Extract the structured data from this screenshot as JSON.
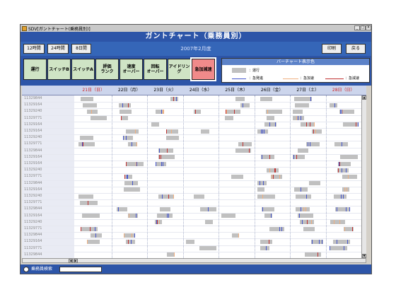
{
  "window": {
    "title": "SDV[ガントチャート(乗務員別)]",
    "min_label": "_",
    "max_label": "□",
    "close_label": "X"
  },
  "banner": {
    "title": "ガントチャート（乗務員別）"
  },
  "toolbar": {
    "range_buttons": [
      "12時間",
      "24時間",
      "8日間"
    ],
    "date_label": "2007年2月度",
    "print_label": "印刷",
    "back_label": "戻る"
  },
  "modes": [
    {
      "label": "運行",
      "active": false
    },
    {
      "label": "スイッチB",
      "active": false
    },
    {
      "label": "スイッチA",
      "active": false
    },
    {
      "label": "評価\nランク",
      "active": false
    },
    {
      "label": "速度\nオーバー",
      "active": false
    },
    {
      "label": "回転\nオーバー",
      "active": false
    },
    {
      "label": "アイドリング",
      "active": false
    },
    {
      "label": "急加減速",
      "active": true
    }
  ],
  "legend": {
    "title": "バーチャート表示色",
    "items": [
      {
        "label": "：運行",
        "color": "#c0c0c0"
      },
      {
        "label": "：急発進",
        "color": "#4455cc"
      },
      {
        "label": "：急加速",
        "color": "#f0b080"
      },
      {
        "label": "：急減速",
        "color": "#c03030"
      }
    ]
  },
  "days": [
    {
      "label": "21日（日）",
      "color": "#cc2222"
    },
    {
      "label": "22日（月）",
      "color": "#000000"
    },
    {
      "label": "23日（火）",
      "color": "#000000"
    },
    {
      "label": "24日（水）",
      "color": "#000000"
    },
    {
      "label": "25日（木）",
      "color": "#000000"
    },
    {
      "label": "26日（金）",
      "color": "#000000"
    },
    {
      "label": "27日（土）",
      "color": "#000000"
    },
    {
      "label": "28日（日）",
      "color": "#cc2222"
    }
  ],
  "crew": [
    "11329844",
    "11329164",
    "11329240",
    "11329771",
    "11329164",
    "11329164",
    "11329240",
    "11329771",
    "11329844",
    "11329164",
    "11329164",
    "11329240",
    "11329771",
    "11329844",
    "11329164",
    "11329240",
    "11329771",
    "11329844",
    "11329164",
    "11329240",
    "11329771",
    "11329844",
    "11329164",
    "11329771",
    "11329844"
  ],
  "footer": {
    "search_label": "乗務員検索",
    "search_value": ""
  },
  "colors": {
    "run": "#c0c0c0",
    "start": "#4455cc",
    "accel": "#f0b080",
    "decel": "#c03030"
  }
}
